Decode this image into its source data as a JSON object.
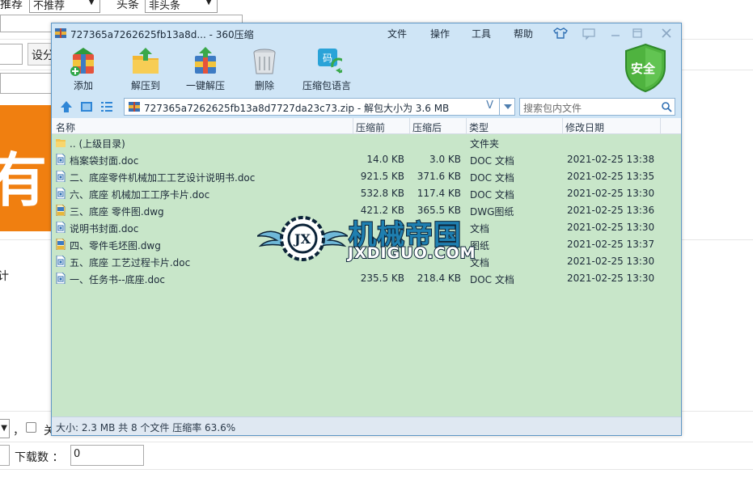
{
  "background_form": {
    "recommend_label": "推荐",
    "recommend_value": "不推荐",
    "headline_label": "头条",
    "headline_value": "非头条",
    "set_button": "设分",
    "banner_char": "有",
    "total_label": "计",
    "comma": "，",
    "close_label": "关",
    "downloads_label": "下载数 ：",
    "downloads_value": "0"
  },
  "window": {
    "title": "727365a7262625fb13a8d... - 360压缩",
    "menu": [
      "文件",
      "操作",
      "工具",
      "帮助"
    ],
    "toolbar": [
      {
        "label": "添加",
        "icon": "add-archive-icon"
      },
      {
        "label": "解压到",
        "icon": "extract-to-icon"
      },
      {
        "label": "一键解压",
        "icon": "one-click-extract-icon"
      },
      {
        "label": "删除",
        "icon": "trash-icon"
      },
      {
        "label": "压缩包语言",
        "icon": "archive-language-icon"
      }
    ],
    "security_badge": "安全",
    "address": "727365a7262625fb13a8d7727da23c73.zip - 解包大小为 3.6 MB",
    "address_suffix": "V",
    "search_placeholder": "搜索包内文件",
    "columns": {
      "name": "名称",
      "packed": "压缩前",
      "unpacked": "压缩后",
      "type": "类型",
      "modified": "修改日期"
    },
    "files": [
      {
        "name": ".. (上级目录)",
        "packed": "",
        "unpacked": "",
        "type": "文件夹",
        "modified": "",
        "icon": "folder-icon"
      },
      {
        "name": "档案袋封面.doc",
        "packed": "14.0 KB",
        "unpacked": "3.0 KB",
        "type": "DOC 文档",
        "modified": "2021-02-25 13:38",
        "icon": "doc-icon"
      },
      {
        "name": "二、底座零件机械加工工艺设计说明书.doc",
        "packed": "921.5 KB",
        "unpacked": "371.6 KB",
        "type": "DOC 文档",
        "modified": "2021-02-25 13:35",
        "icon": "doc-icon"
      },
      {
        "name": "六、底座  机械加工工序卡片.doc",
        "packed": "532.8 KB",
        "unpacked": "117.4 KB",
        "type": "DOC 文档",
        "modified": "2021-02-25 13:30",
        "icon": "doc-icon"
      },
      {
        "name": "三、底座 零件图.dwg",
        "packed": "421.2 KB",
        "unpacked": "365.5 KB",
        "type": "DWG图纸",
        "modified": "2021-02-25 13:36",
        "icon": "dwg-icon"
      },
      {
        "name": "说明书封面.doc",
        "packed": "",
        "unpacked": "",
        "type": "文档",
        "modified": "2021-02-25 13:30",
        "icon": "doc-icon"
      },
      {
        "name": "四、零件毛坯图.dwg",
        "packed": "",
        "unpacked": "",
        "type": "图纸",
        "modified": "2021-02-25 13:37",
        "icon": "dwg-icon"
      },
      {
        "name": "五、底座 工艺过程卡片.doc",
        "packed": "",
        "unpacked": "",
        "type": "文档",
        "modified": "2021-02-25 13:30",
        "icon": "doc-icon"
      },
      {
        "name": "一、任务书--底座.doc",
        "packed": "235.5 KB",
        "unpacked": "218.4 KB",
        "type": "DOC 文档",
        "modified": "2021-02-25 13:30",
        "icon": "doc-icon"
      }
    ],
    "status": "大小: 2.3 MB 共 8 个文件 压缩率 63.6%"
  },
  "watermark": {
    "cn": "机械帝国",
    "en": "JXDIGUO.COM"
  },
  "colors": {
    "list_background": "#c8e6c9",
    "window_chrome": "#cfe5f6",
    "banner_orange": "#f07f10"
  }
}
